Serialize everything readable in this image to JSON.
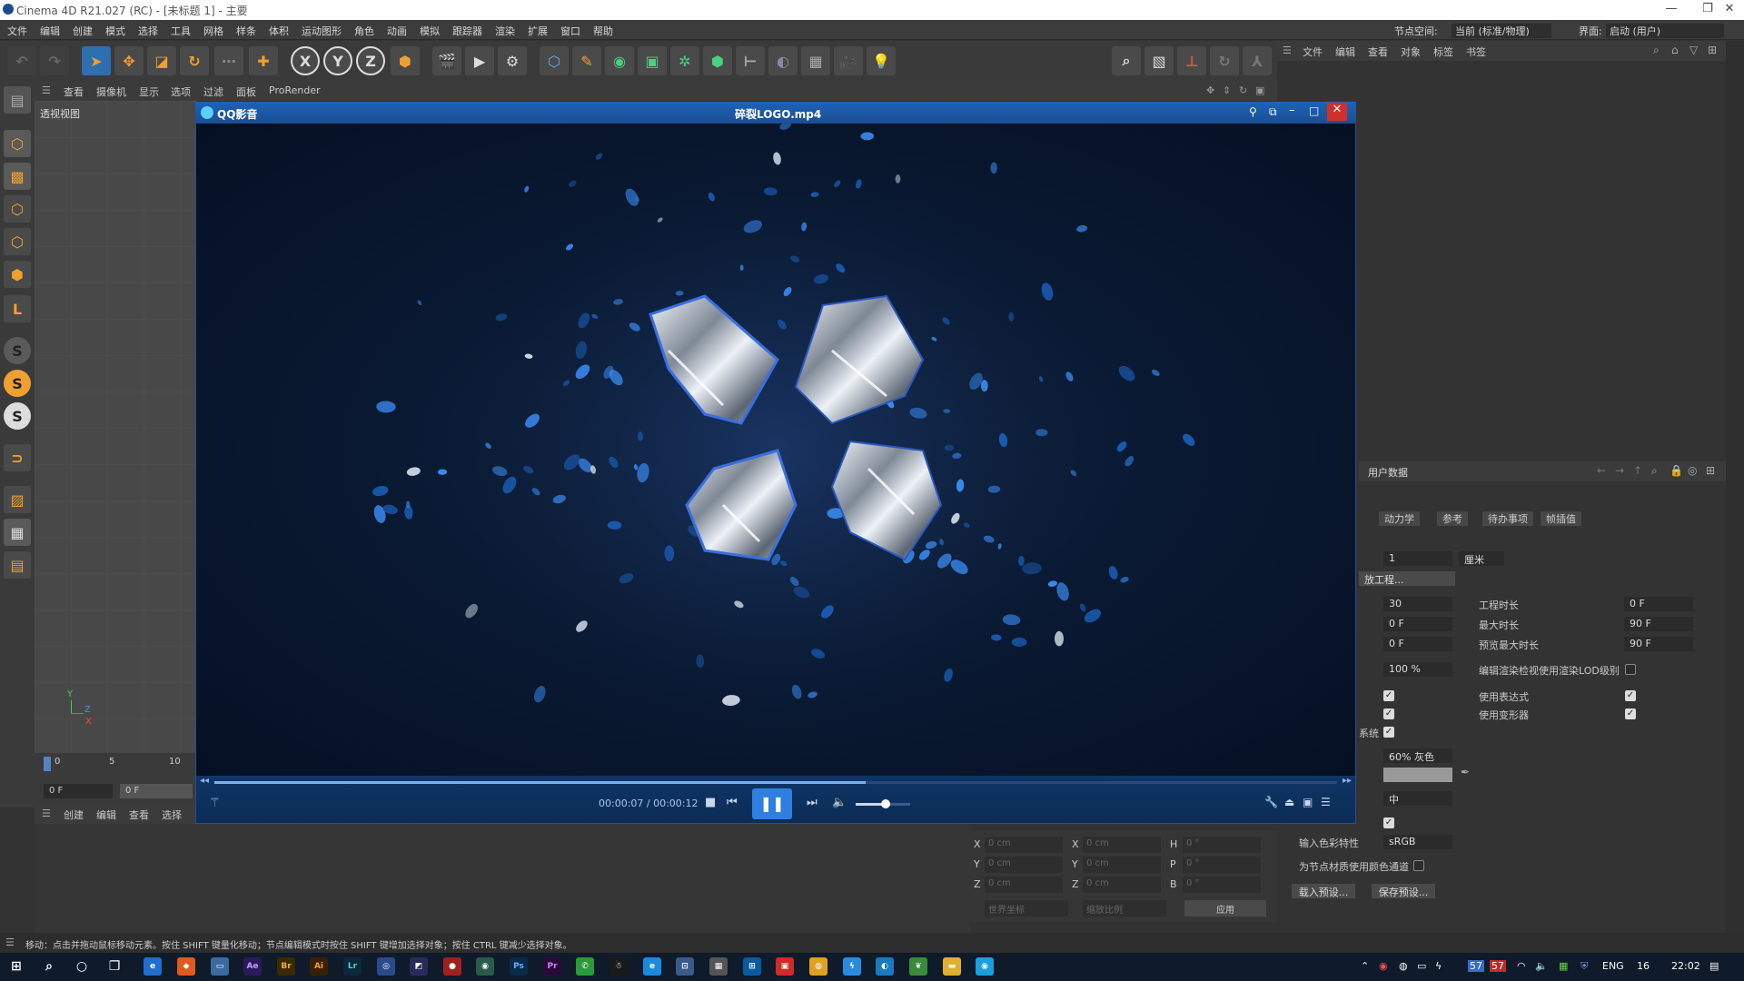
{
  "window": {
    "title": "Cinema 4D R21.027 (RC) - [未标题 1] - 主要"
  },
  "menu": [
    "文件",
    "编辑",
    "创建",
    "模式",
    "选择",
    "工具",
    "网格",
    "样条",
    "体积",
    "运动图形",
    "角色",
    "动画",
    "模拟",
    "跟踪器",
    "渲染",
    "扩展",
    "窗口",
    "帮助"
  ],
  "menu_right": {
    "node_space_label": "节点空间:",
    "node_space_value": "当前 (标准/物理)",
    "layout_label": "界面:",
    "layout_value": "启动 (用户)"
  },
  "toolbar": {
    "x": "X",
    "y": "Y",
    "z": "Z"
  },
  "viewport_menu": [
    "查看",
    "摄像机",
    "显示",
    "选项",
    "过滤",
    "面板",
    "ProRender"
  ],
  "viewport": {
    "label": "透视视图",
    "axis_y": "Y",
    "axis_x": "X",
    "axis_z": "Z"
  },
  "timeline": {
    "ticks": [
      "0",
      "5",
      "10"
    ],
    "frame_a": "0 F",
    "frame_b": "0 F"
  },
  "bottom_menu": [
    "创建",
    "编辑",
    "查看",
    "选择"
  ],
  "coords": {
    "rows": [
      {
        "a": "X",
        "av": "0 cm",
        "b": "X",
        "bv": "0 cm",
        "c": "H",
        "cv": "0 °"
      },
      {
        "a": "Y",
        "av": "0 cm",
        "b": "Y",
        "bv": "0 cm",
        "c": "P",
        "cv": "0 °"
      },
      {
        "a": "Z",
        "av": "0 cm",
        "b": "Z",
        "bv": "0 cm",
        "c": "B",
        "cv": "0 °"
      }
    ],
    "world": "世界坐标",
    "scale": "缩放比例",
    "apply": "应用"
  },
  "object_manager": {
    "menu": [
      "文件",
      "编辑",
      "查看",
      "对象",
      "标签",
      "书签"
    ]
  },
  "attr": {
    "header": "用户数据",
    "tabs": [
      "动力学",
      "参考",
      "待办事项",
      "帧插值"
    ],
    "scale_value": "1",
    "scale_unit": "厘米",
    "project_btn": "放工程...",
    "fps": "30",
    "min": "0 F",
    "pmin": "0 F",
    "lod": "100 %",
    "proj_len_label": "工程时长",
    "proj_len": "0 F",
    "max_label": "最大时长",
    "max": "90 F",
    "pmax_label": "预览最大时长",
    "pmax": "90 F",
    "lod_label": "编辑渲染检视使用渲染LOD级别",
    "expr_label": "使用表达式",
    "deform_label": "使用变形器",
    "sys_label": "系统",
    "color": "60% 灰色",
    "mid": "中",
    "input_cs_label": "输入色彩特性",
    "input_cs": "sRGB",
    "node_color_label": "为节点材质使用颜色通道",
    "load_preset": "载入预设...",
    "save_preset": "保存预设..."
  },
  "player": {
    "app": "QQ影音",
    "file": "碎裂LOGO.mp4",
    "time": "00:00:07 / 00:00:12",
    "progress": 0.58,
    "volume": 0.55
  },
  "status": "移动：点击并拖动鼠标移动元素。按住 SHIFT 键量化移动；节点编辑模式时按住 SHIFT 键增加选择对象；按住 CTRL 键减少选择对象。",
  "taskbar": {
    "lang": "ENG",
    "num": "16",
    "time": "22:02",
    "badge1": "57",
    "badge2": "57"
  }
}
